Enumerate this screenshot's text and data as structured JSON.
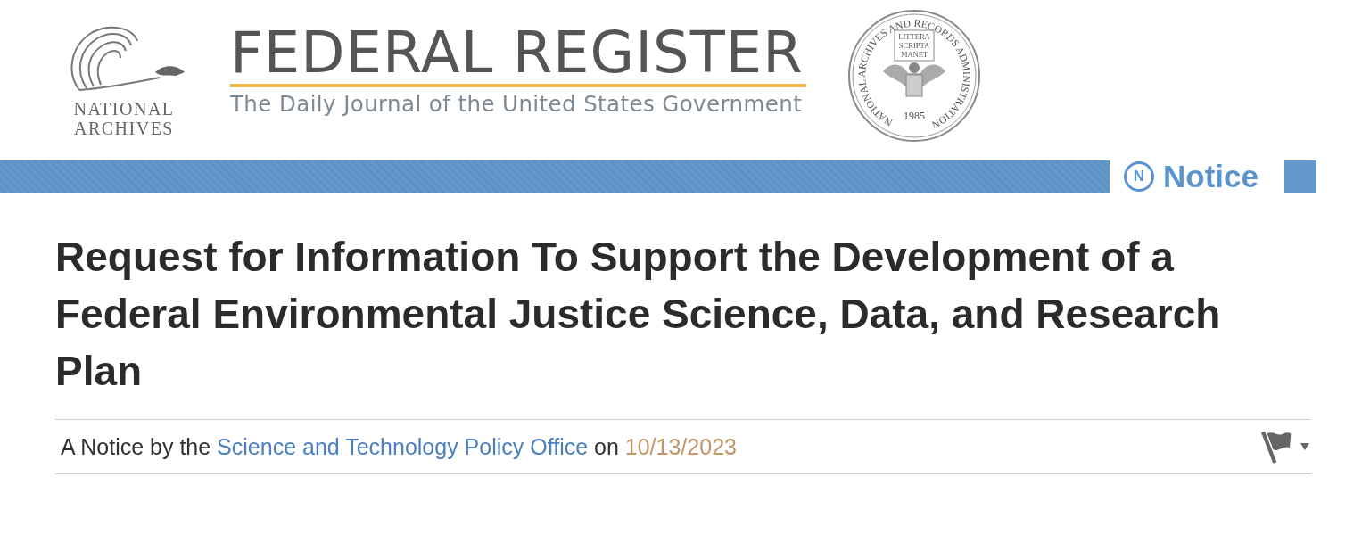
{
  "header": {
    "archives_logo": {
      "lines": [
        "NATIONAL",
        "ARCHIVES"
      ]
    },
    "title": "FEDERAL REGISTER",
    "subtitle": "The Daily Journal of the United States Government",
    "seal": {
      "ring_text": "NATIONAL ARCHIVES AND RECORDS ADMINISTRATION",
      "scroll_lines": [
        "LITTERA",
        "SCRIPTA",
        "MANET"
      ],
      "year": "1985"
    }
  },
  "document_type": {
    "badge_letter": "N",
    "label": "Notice"
  },
  "document": {
    "title": "Request for Information To Support the Development of a Federal Environmental Justice Science, Data, and Research Plan",
    "byline": {
      "prefix": "A Notice by the",
      "agency": "Science and Technology Policy Office",
      "connector": "on",
      "date": "10/13/2023"
    }
  }
}
